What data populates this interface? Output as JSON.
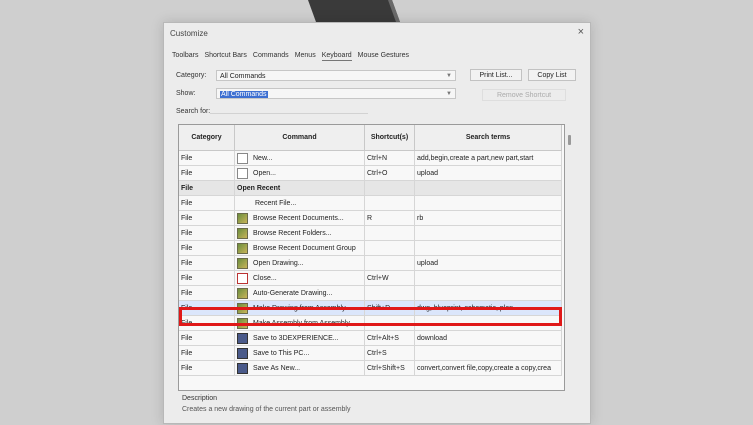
{
  "window": {
    "title": "Customize",
    "close_glyph": "×"
  },
  "tabs": [
    "Toolbars",
    "Shortcut Bars",
    "Commands",
    "Menus",
    "Keyboard",
    "Mouse Gestures"
  ],
  "active_tab": 4,
  "filters": {
    "category_label": "Category:",
    "category_value": "All Commands",
    "show_label": "Show:",
    "show_value": "All Commands",
    "search_label": "Search for:",
    "search_value": ""
  },
  "buttons": {
    "print_list": "Print List...",
    "copy_list": "Copy List",
    "remove_shortcut": "Remove Shortcut"
  },
  "table": {
    "headers": [
      "Category",
      "Command",
      "Shortcut(s)",
      "Search terms"
    ],
    "rows": [
      {
        "category": "File",
        "command": "New...",
        "icon": "doc",
        "shortcut": "Ctrl+N",
        "search": "add,begin,create a part,new part,start"
      },
      {
        "category": "File",
        "command": "Open...",
        "icon": "doc",
        "shortcut": "Ctrl+O",
        "search": "upload"
      },
      {
        "category": "File",
        "command": "Open Recent",
        "icon": "",
        "shortcut": "",
        "search": "",
        "group": true
      },
      {
        "category": "File",
        "command": "Recent File...",
        "icon": "",
        "shortcut": "",
        "search": ""
      },
      {
        "category": "File",
        "command": "Browse Recent Documents...",
        "icon": "img",
        "shortcut": "R",
        "search": "rb"
      },
      {
        "category": "File",
        "command": "Browse Recent Folders...",
        "icon": "img",
        "shortcut": "",
        "search": ""
      },
      {
        "category": "File",
        "command": "Browse Recent Document Group",
        "icon": "img",
        "shortcut": "",
        "search": ""
      },
      {
        "category": "File",
        "command": "Open Drawing...",
        "icon": "img",
        "shortcut": "",
        "search": "upload"
      },
      {
        "category": "File",
        "command": "Close...",
        "icon": "red",
        "shortcut": "Ctrl+W",
        "search": ""
      },
      {
        "category": "File",
        "command": "Auto-Generate Drawing...",
        "icon": "img",
        "shortcut": "",
        "search": ""
      },
      {
        "category": "File",
        "command": "Make Drawing from Assembly...",
        "icon": "img",
        "shortcut": "Shift+D",
        "search": "dwg, blueprint, schematic, plan",
        "highlight": true
      },
      {
        "category": "File",
        "command": "Make Assembly from Assembly...",
        "icon": "img",
        "shortcut": "",
        "search": ""
      },
      {
        "category": "File",
        "command": "Save to 3DEXPERIENCE...",
        "icon": "save",
        "shortcut": "Ctrl+Alt+S",
        "search": "download"
      },
      {
        "category": "File",
        "command": "Save to This PC...",
        "icon": "save",
        "shortcut": "Ctrl+S",
        "search": ""
      },
      {
        "category": "File",
        "command": "Save As New...",
        "icon": "save",
        "shortcut": "Ctrl+Shift+S",
        "search": "convert,convert file,copy,create a copy,crea"
      }
    ]
  },
  "description": {
    "label": "Description",
    "text": "Creates a new drawing of the current part or assembly"
  }
}
